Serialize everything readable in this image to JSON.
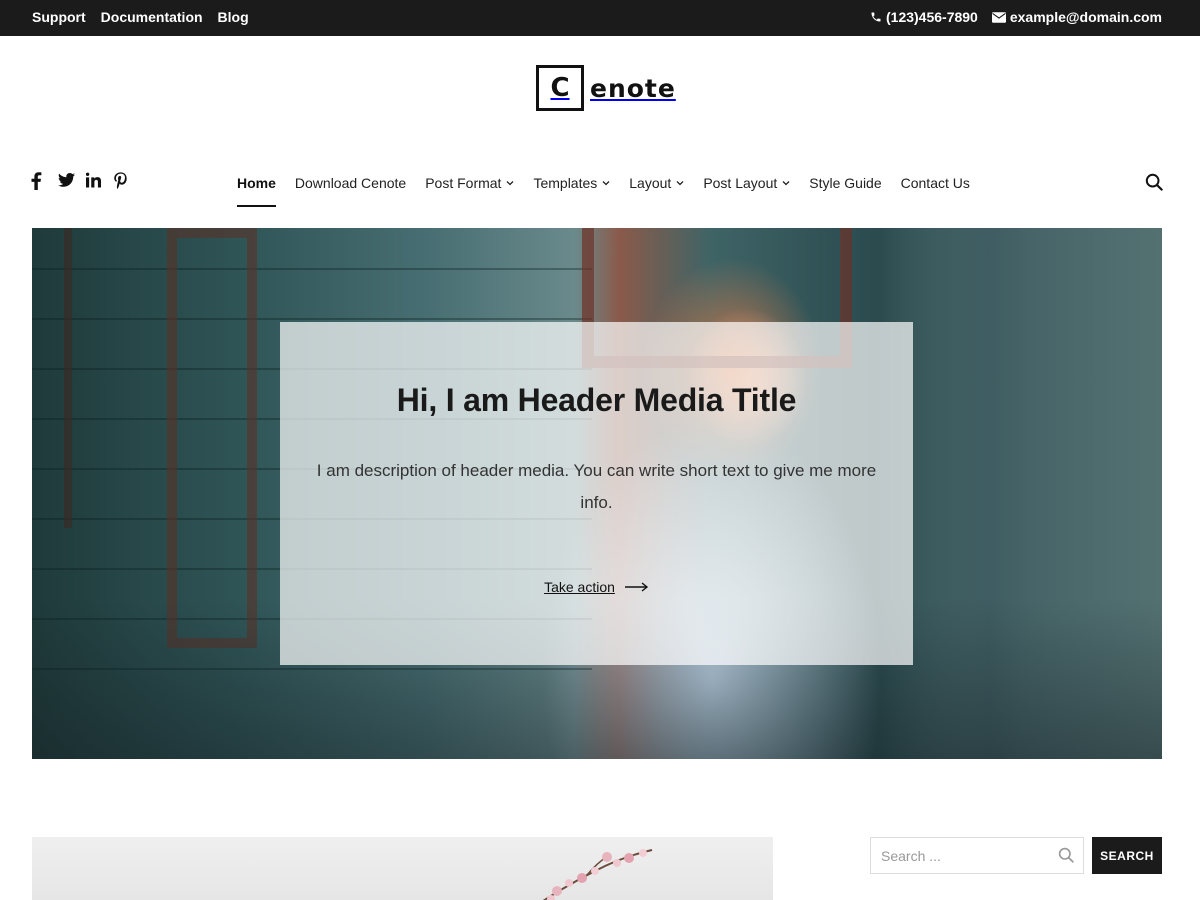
{
  "topbar": {
    "links": [
      "Support",
      "Documentation",
      "Blog"
    ],
    "phone": "(123)456-7890",
    "email": "example@domain.com",
    "phone_icon": "phone-icon",
    "email_icon": "envelope-icon"
  },
  "logo": {
    "initial": "C",
    "rest": "enote"
  },
  "social": [
    "facebook-icon",
    "twitter-icon",
    "linkedin-icon",
    "pinterest-icon"
  ],
  "nav": {
    "items": [
      {
        "label": "Home",
        "active": true,
        "dropdown": false
      },
      {
        "label": "Download Cenote",
        "active": false,
        "dropdown": false
      },
      {
        "label": "Post Format",
        "active": false,
        "dropdown": true
      },
      {
        "label": "Templates",
        "active": false,
        "dropdown": true
      },
      {
        "label": "Layout",
        "active": false,
        "dropdown": true
      },
      {
        "label": "Post Layout",
        "active": false,
        "dropdown": true
      },
      {
        "label": "Style Guide",
        "active": false,
        "dropdown": false
      },
      {
        "label": "Contact Us",
        "active": false,
        "dropdown": false
      }
    ]
  },
  "hero": {
    "title": "Hi, I am Header Media Title",
    "description": "I am description of header media. You can write short text to give me more info.",
    "cta": "Take action"
  },
  "sidebar": {
    "search_placeholder": "Search ...",
    "search_button": "SEARCH"
  },
  "colors": {
    "topbar_bg": "#1b1b1b",
    "text_dark": "#111111",
    "button_bg": "#1b1b1b"
  }
}
